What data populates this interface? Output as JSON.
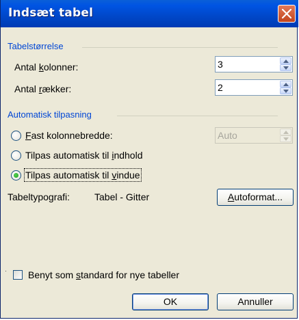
{
  "window": {
    "title": "Indsæt tabel"
  },
  "table_size": {
    "section_label": "Tabelstørrelse",
    "columns_label_pre": "Antal ",
    "columns_label_key": "k",
    "columns_label_post": "olonner:",
    "columns_value": "3",
    "rows_label_pre": "Antal ",
    "rows_label_key": "r",
    "rows_label_post": "ækker:",
    "rows_value": "2"
  },
  "autofit": {
    "section_label": "Automatisk tilpasning",
    "fixed_key": "F",
    "fixed_post": "ast kolonnebredde:",
    "fixed_value": "Auto",
    "content_pre": "Tilpas automatisk til ",
    "content_key": "i",
    "content_post": "ndhold",
    "window_pre": "Tilpas automatisk til ",
    "window_key": "v",
    "window_post": "indue",
    "selected": "window"
  },
  "typography": {
    "label": "Tabeltypografi:",
    "value": "Tabel - Gitter",
    "autoformat_key": "A",
    "autoformat_post": "utoformat..."
  },
  "default_checkbox": {
    "pre": "Benyt som ",
    "key": "s",
    "post": "tandard for nye tabeller",
    "checked": false
  },
  "buttons": {
    "ok": "OK",
    "cancel": "Annuller"
  }
}
